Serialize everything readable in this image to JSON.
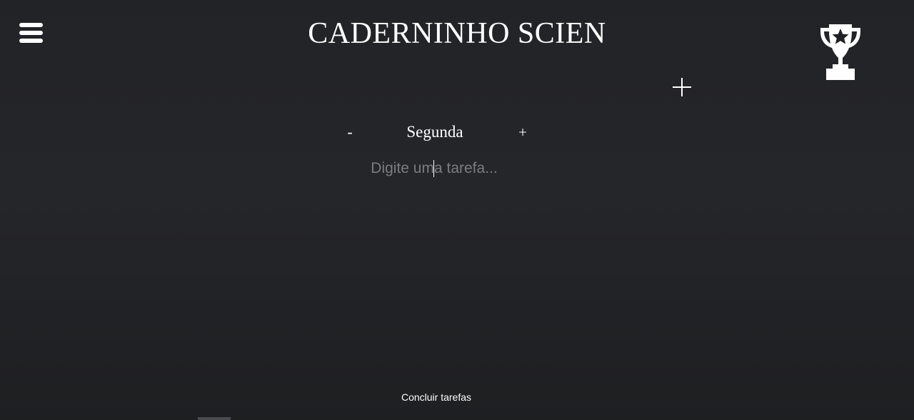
{
  "header": {
    "title": "CADERNINHO SCIEN",
    "menu_icon": "hamburger-menu-icon",
    "achievements_icon": "trophy-icon",
    "add_icon": "plus-icon"
  },
  "day_selector": {
    "prev_label": "-",
    "day_label": "Segunda",
    "next_label": "+"
  },
  "task_input": {
    "placeholder": "Digite uma tarefa...",
    "value": ""
  },
  "footer": {
    "complete_label": "Concluir tarefas"
  },
  "colors": {
    "background": "#232427",
    "text": "#ffffff",
    "placeholder": "#7b7c80"
  }
}
